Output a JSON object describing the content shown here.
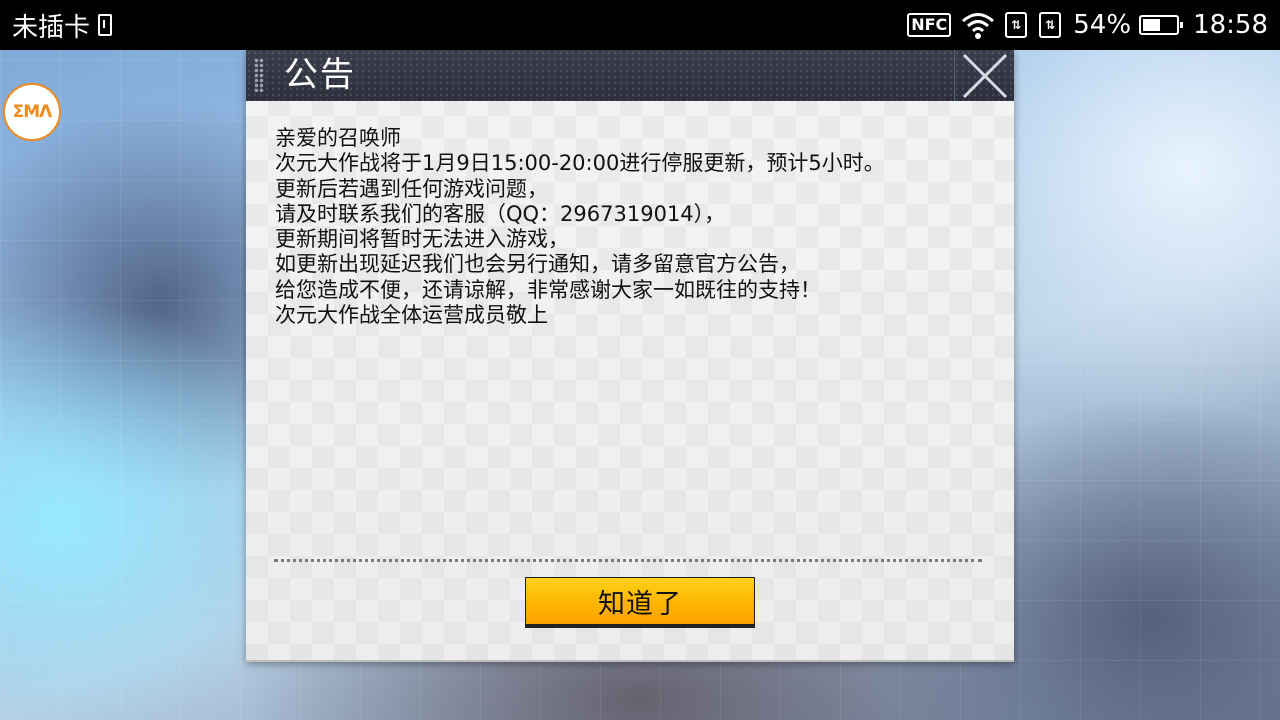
{
  "status_bar": {
    "carrier": "未插卡",
    "nfc_label": "NFC",
    "battery_percent": "54%",
    "battery_level": 0.54,
    "time": "18:58",
    "icons": [
      "sim-icon",
      "nfc-icon",
      "wifi-icon",
      "data-icon",
      "data-icon",
      "battery-icon"
    ]
  },
  "app_badge": {
    "label": "ΣMΛ"
  },
  "dialog": {
    "title": "公告",
    "body_lines": [
      "亲爱的召唤师",
      "次元大作战将于1月9日15:00-20:00进行停服更新，预计5小时。",
      "更新后若遇到任何游戏问题，",
      "请及时联系我们的客服（QQ：2967319014），",
      "更新期间将暂时无法进入游戏，",
      "如更新出现延迟我们也会另行通知，请多留意官方公告，",
      "给您造成不便，还请谅解，非常感谢大家一如既往的支持！",
      "次元大作战全体运营成员敬上"
    ],
    "confirm_label": "知道了"
  },
  "colors": {
    "status_bar_bg": "#000000",
    "header_bg": "#2d2f3c",
    "button_accent": "#ffb400",
    "badge_accent": "#f08a1c"
  }
}
